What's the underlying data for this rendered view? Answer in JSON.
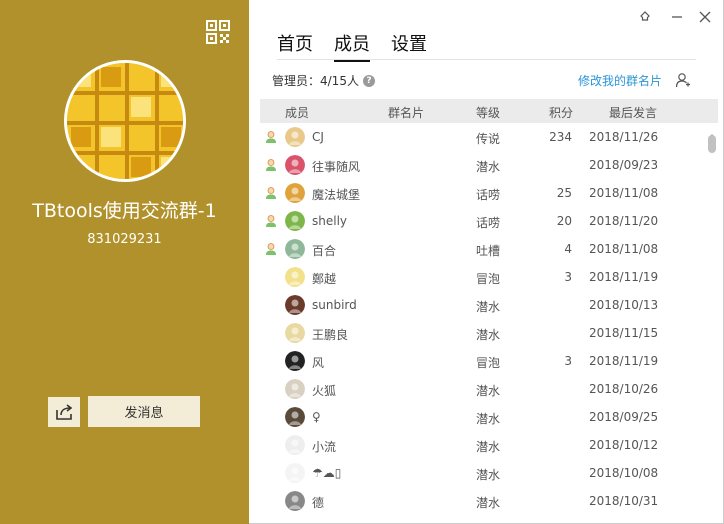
{
  "group": {
    "name": "TBtools使用交流群-1",
    "id": "831029231",
    "send_label": "发消息"
  },
  "tabs": [
    {
      "label": "首页"
    },
    {
      "label": "成员"
    },
    {
      "label": "设置"
    }
  ],
  "admin": {
    "label": "管理员：4/15人",
    "help": "?"
  },
  "edit_card": "修改我的群名片",
  "columns": {
    "member": "成员",
    "card": "群名片",
    "level": "等级",
    "points": "积分",
    "last_speak": "最后发言"
  },
  "members": [
    {
      "name": "CJ",
      "level": "传说",
      "points": "234",
      "date": "2018/11/26",
      "admin": true,
      "color": "#e8c98a"
    },
    {
      "name": "往事随风",
      "level": "潜水",
      "points": "",
      "date": "2018/09/23",
      "admin": true,
      "color": "#d9546a"
    },
    {
      "name": "魔法城堡",
      "level": "话唠",
      "points": "25",
      "date": "2018/11/08",
      "admin": true,
      "color": "#e0a23a"
    },
    {
      "name": "shelly",
      "level": "话唠",
      "points": "20",
      "date": "2018/11/20",
      "admin": true,
      "color": "#7fb64a"
    },
    {
      "name": "百合",
      "level": "吐槽",
      "points": "4",
      "date": "2018/11/08",
      "admin": true,
      "color": "#8fb89a"
    },
    {
      "name": "鄭越",
      "level": "冒泡",
      "points": "3",
      "date": "2018/11/19",
      "admin": false,
      "color": "#f2e08a"
    },
    {
      "name": "sunbird",
      "level": "潜水",
      "points": "",
      "date": "2018/10/13",
      "admin": false,
      "color": "#6a3a2a"
    },
    {
      "name": "王鹏良",
      "level": "潜水",
      "points": "",
      "date": "2018/11/15",
      "admin": false,
      "color": "#e8d9a0"
    },
    {
      "name": "风",
      "level": "冒泡",
      "points": "3",
      "date": "2018/11/19",
      "admin": false,
      "color": "#222222"
    },
    {
      "name": "火狐",
      "level": "潜水",
      "points": "",
      "date": "2018/10/26",
      "admin": false,
      "color": "#d8d0c0"
    },
    {
      "name": "♀",
      "level": "潜水",
      "points": "",
      "date": "2018/09/25",
      "admin": false,
      "color": "#5a4a3a"
    },
    {
      "name": "小流",
      "level": "潜水",
      "points": "",
      "date": "2018/10/12",
      "admin": false,
      "color": "#eeeeee"
    },
    {
      "name": "☂☁▯",
      "level": "潜水",
      "points": "",
      "date": "2018/10/08",
      "admin": false,
      "color": "#f4f4f4"
    },
    {
      "name": "德",
      "level": "潜水",
      "points": "",
      "date": "2018/10/31",
      "admin": false,
      "color": "#888888"
    }
  ],
  "colors": {
    "sidebar": "#b0912b",
    "link": "#2b95d6",
    "button_bg": "#f3ecd7"
  }
}
